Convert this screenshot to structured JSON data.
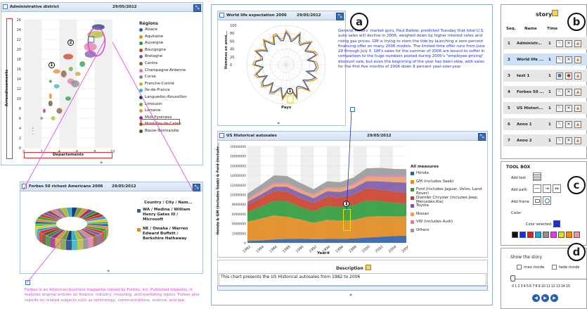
{
  "colors": {
    "accent": "#3a6fb5",
    "annotation_red": "#e03030",
    "annotation_pink": "#e040e0",
    "blue_text": "#2030c0",
    "pink_text": "#e040e0"
  },
  "labels": {
    "a": "a",
    "b": "b",
    "c": "c",
    "d": "d"
  },
  "bubble_panel": {
    "title": "Administrative district",
    "date": "29/05/2012",
    "ylabel": "Arrondissements",
    "xlabel": "Départements",
    "yticks": [
      "26",
      "24",
      "22",
      "20",
      "18",
      "16",
      "14",
      "12",
      "10",
      "8",
      "6",
      "4",
      "2",
      "0"
    ],
    "xticks": [
      "0",
      "2",
      "4",
      "6",
      "8",
      "10"
    ],
    "legend_title": "Régions",
    "markers": {
      "one": "1",
      "two": "2"
    },
    "legend": [
      {
        "label": "Alsace",
        "color": "#2c5fa8"
      },
      {
        "label": "Aquitaine",
        "color": "#e08a20"
      },
      {
        "label": "Auvergne",
        "color": "#2e9a3a"
      },
      {
        "label": "Bourgogne",
        "color": "#c8402a"
      },
      {
        "label": "Bretagne",
        "color": "#7a5aa8"
      },
      {
        "label": "Centre",
        "color": "#8a5a3a"
      },
      {
        "label": "Champagne-Ardenne",
        "color": "#e07aa8"
      },
      {
        "label": "Corse",
        "color": "#888888"
      },
      {
        "label": "Franche-Comté",
        "color": "#b8b830"
      },
      {
        "label": "Île-de-France",
        "color": "#30b0c0"
      },
      {
        "label": "Languedoc-Roussillon",
        "color": "#1a3a7a"
      },
      {
        "label": "Limousin",
        "color": "#7a9a3a"
      },
      {
        "label": "Lorraine",
        "color": "#c8a040"
      },
      {
        "label": "Midi-Pyrénées",
        "color": "#a02a8a"
      },
      {
        "label": "Nord-Pas-de-Calais",
        "color": "#3a8a3a"
      },
      {
        "label": "Basse-Normandie",
        "color": "#6a4a2a"
      }
    ]
  },
  "forbes_panel": {
    "title": "Forbes 50 richest Americans 2006",
    "date": "29/05/2012",
    "legend_title": "Country / City / Nam...",
    "legend": [
      {
        "label": "WA / Medina / William Henry Gates III / Microsoft",
        "color": "#2c5fa8"
      },
      {
        "label": "NE / Omaha / Warren Edward Buffett / Berkshire Hathaway",
        "color": "#e08a20"
      }
    ],
    "description": "Forbes is an American business magazine owned by Forbes, Inc. Published biweekly, it features original articles on finance, industry, investing, and marketing topics. Forbes also reports on related subjects such as technology, communications, science, and law."
  },
  "radar_panel": {
    "title": "World life expectation 2006",
    "date": "29/05/2012",
    "ylabel": "Hommes en anné...",
    "xlabel": "Pays",
    "yticks": [
      "100",
      "80",
      "60",
      "40",
      "20",
      "0"
    ],
    "marker": "1",
    "text": "General Motors' market guru, Paul Ballew, predicted Tuesday that total U.S. auto sales will decline in 2006, weighed down by higher interest rates and rising gas prices. GM is trying to stem the tide by launching a zero-percent financing offer on many 2006 models. The limited-time offer runs from June 29 through July 5. GM's sales for the summer of 2006 are bound to suffer in comparison to the huge numbers posted during 2005's \"employee-pricing\" discount sale, but even the beginning of the year has been slow, with sales for the first five months of 2006 down 8 percent year-over-year."
  },
  "area_panel": {
    "title": "US Historical autosales",
    "date": "29/05/2012",
    "ylabel": "Honda & GM (includes Saab) & Ford (include...",
    "xlabel": "Year#",
    "yticks": [
      "20000000",
      "18000000",
      "16000000",
      "14000000",
      "12000000",
      "10000000",
      "8000000",
      "6000000",
      "4000000",
      "2000000",
      "0"
    ],
    "xticks": [
      "1982",
      "1984",
      "1986",
      "1988",
      "1990",
      "1992",
      "1994",
      "1996",
      "1998",
      "2000",
      "2002",
      "2004",
      "2006"
    ],
    "legend_title": "All measures",
    "marker": "1",
    "legend": [
      {
        "label": "Honda",
        "color": "#2c5fa8"
      },
      {
        "label": "GM (includes Saab)",
        "color": "#e08a20"
      },
      {
        "label": "Ford (includes Jaguar, Volvo, Land Rover)",
        "color": "#2e9a3a"
      },
      {
        "label": "Diamler Chrysler (includes Jeep, Mercedes,Kia)",
        "color": "#c8402a"
      },
      {
        "label": "Toyota",
        "color": "#7a5aa8"
      },
      {
        "label": "Nissan",
        "color": "#e8a06a"
      },
      {
        "label": "VW (includes Audi)",
        "color": "#e07aa8"
      },
      {
        "label": "Others",
        "color": "#999999"
      }
    ],
    "description_label": "Description :",
    "description_text": "This chart presents the US Historical autosales from 1982 to 2006"
  },
  "chart_data": {
    "type": "area",
    "x": [
      "1982",
      "1984",
      "1986",
      "1988",
      "1990",
      "1992",
      "1994",
      "1996",
      "1998",
      "2000",
      "2002",
      "2004",
      "2006"
    ],
    "ylim": [
      0,
      20000000
    ],
    "xlabel": "Year#",
    "ylabel": "Honda & GM (includes Saab) & Ford (include...",
    "series": [
      {
        "name": "Honda",
        "values": [
          400000,
          500000,
          700000,
          800000,
          850000,
          750000,
          800000,
          800000,
          900000,
          1100000,
          1250000,
          1400000,
          1500000
        ]
      },
      {
        "name": "GM (includes Saab)",
        "values": [
          4000000,
          4500000,
          5000000,
          4600000,
          4000000,
          3400000,
          4000000,
          3800000,
          3800000,
          4300000,
          4300000,
          4100000,
          4000000
        ]
      },
      {
        "name": "Ford (includes Jaguar, Volvo, Land Rover)",
        "values": [
          2000000,
          2500000,
          3000000,
          3200000,
          2600000,
          2400000,
          2900000,
          2800000,
          3100000,
          3400000,
          3100000,
          2800000,
          2600000
        ]
      },
      {
        "name": "Diamler Chrysler (includes Jeep, Mercedes,Kia)",
        "values": [
          1500000,
          1800000,
          2000000,
          2000000,
          1800000,
          1700000,
          1900000,
          2000000,
          2200000,
          2500000,
          2400000,
          2400000,
          2300000
        ]
      },
      {
        "name": "Toyota",
        "values": [
          600000,
          700000,
          900000,
          1000000,
          1100000,
          1000000,
          1100000,
          1150000,
          1300000,
          1500000,
          1700000,
          1900000,
          2100000
        ]
      },
      {
        "name": "Nissan",
        "values": [
          500000,
          550000,
          600000,
          600000,
          650000,
          600000,
          650000,
          650000,
          700000,
          800000,
          900000,
          1000000,
          1100000
        ]
      },
      {
        "name": "VW (includes Audi)",
        "values": [
          200000,
          250000,
          300000,
          250000,
          200000,
          180000,
          200000,
          200000,
          250000,
          350000,
          400000,
          350000,
          300000
        ]
      },
      {
        "name": "Others",
        "values": [
          1000000,
          1200000,
          1500000,
          1400000,
          1200000,
          1100000,
          1200000,
          1200000,
          1300000,
          1500000,
          1500000,
          1400000,
          1400000
        ]
      }
    ]
  },
  "story": {
    "title": "story",
    "col_seq": "Seq.",
    "col_name": "Name",
    "col_time": "Time",
    "rows": [
      {
        "seq": "1",
        "name": "Administr...",
        "time": "1"
      },
      {
        "seq": "2",
        "name": "World life ...",
        "time": "1"
      },
      {
        "seq": "3",
        "name": "text 1",
        "time": "1"
      },
      {
        "seq": "4",
        "name": "Forbes 50 ...",
        "time": "1"
      },
      {
        "seq": "5",
        "name": "US Histori...",
        "time": "1"
      },
      {
        "seq": "6",
        "name": "Anno 1",
        "time": "1"
      },
      {
        "seq": "7",
        "name": "Anno 2",
        "time": "1"
      }
    ]
  },
  "toolbox": {
    "title": "TOOL BOX",
    "add_text": "Add text",
    "add_path": "Add path",
    "add_frame": "Add frame",
    "color_title": "Color",
    "color_selected": "Color selected:",
    "selected_color": "#1a2ee0",
    "palette": [
      "#111111",
      "#1a2ee0",
      "#e02020",
      "#20a0e0",
      "#909090",
      "#e040e0",
      "#e0e020",
      "#ff8a00",
      "#ff9090"
    ]
  },
  "show": {
    "title": "Show the story",
    "max_mode": "max mode",
    "fade_mode": "fade mode",
    "ticks": "0 1 2 3 4 5 6 7 8 9 10 11 12 13 14 15"
  }
}
